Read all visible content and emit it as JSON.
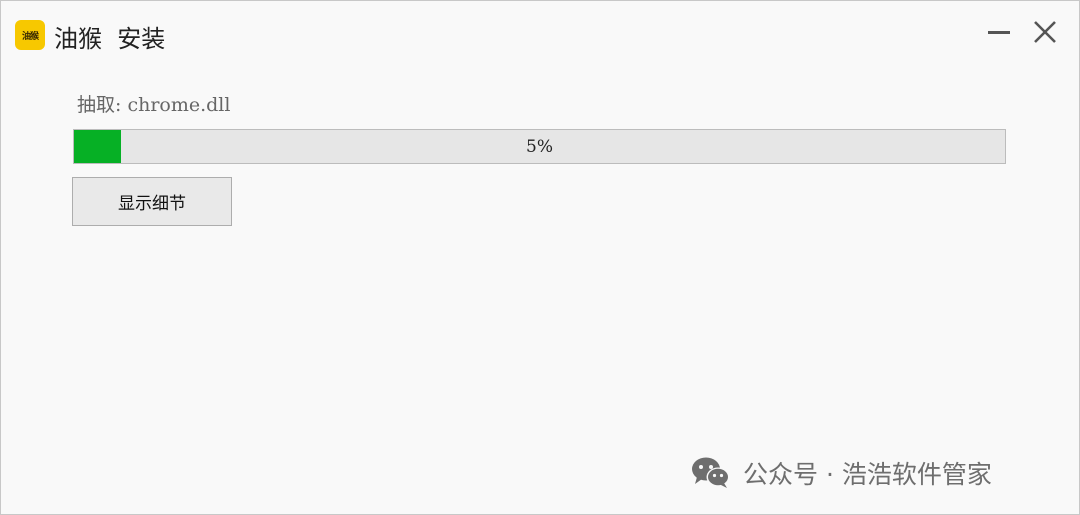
{
  "titlebar": {
    "app_icon_text": "油猴",
    "title": "油猴  安装",
    "icons": {
      "minimize": "minimize-icon",
      "close": "close-icon"
    }
  },
  "main": {
    "status_text": "抽取: chrome.dll",
    "progress": {
      "value": 5,
      "label": "5%",
      "fill_color": "#06b025"
    },
    "details_button_label": "显示细节"
  },
  "watermark": {
    "icon": "wechat-icon",
    "text": "公众号 · 浩浩软件管家"
  }
}
